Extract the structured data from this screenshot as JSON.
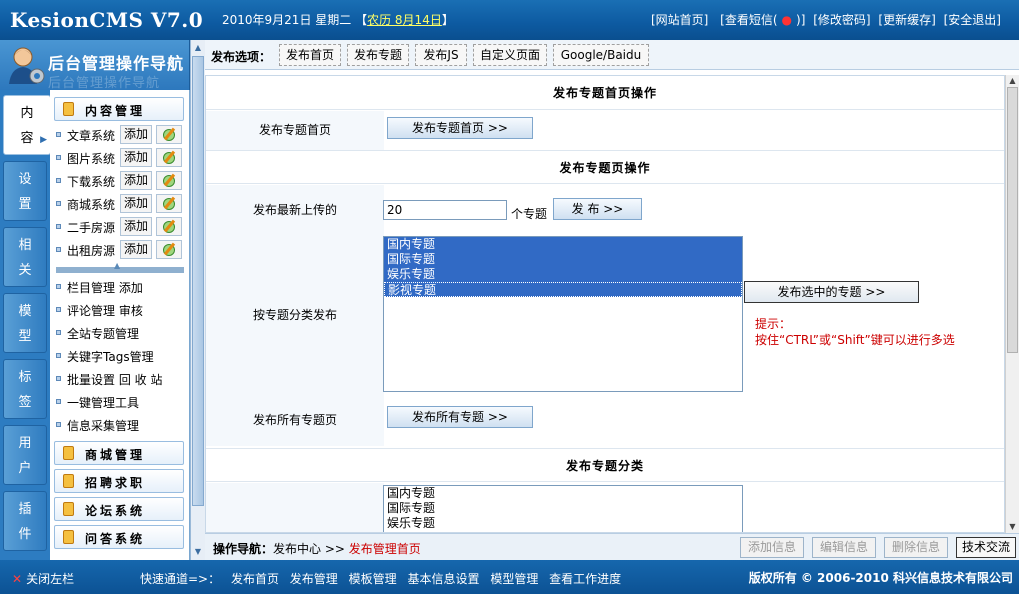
{
  "header": {
    "logo": "KesionCMS V7.0",
    "date": "2010年9月21日 星期二",
    "lunar_prefix": "【",
    "lunar": "农历 8月14日",
    "lunar_suffix": "】",
    "links": [
      "[网站首页]",
      "[查看短信(",
      ")]",
      "[修改密码]",
      "[更新缓存]",
      "[安全退出]"
    ]
  },
  "nav": {
    "title": "后台管理操作导航",
    "title_shadow": "后台管理操作导航",
    "vtabs": [
      {
        "label": "内容",
        "active": true
      },
      {
        "label": "设置"
      },
      {
        "label": "相关"
      },
      {
        "label": "模型"
      },
      {
        "label": "标签"
      },
      {
        "label": "用户"
      },
      {
        "label": "插件"
      }
    ],
    "group_content": "内容管理",
    "items_with_actions": [
      {
        "label": "文章系统",
        "add": "添加"
      },
      {
        "label": "图片系统",
        "add": "添加"
      },
      {
        "label": "下载系统",
        "add": "添加"
      },
      {
        "label": "商城系统",
        "add": "添加"
      },
      {
        "label": "二手房源",
        "add": "添加"
      },
      {
        "label": "出租房源",
        "add": "添加"
      }
    ],
    "items": [
      "栏目管理 添加",
      "评论管理 审核",
      "全站专题管理",
      "关键字Tags管理",
      "批量设置 回 收 站",
      "一键管理工具",
      "信息采集管理"
    ],
    "groups": [
      "商城管理",
      "招聘求职",
      "论坛系统",
      "问答系统"
    ]
  },
  "options": {
    "label": "发布选项：",
    "tabs": [
      "发布首页",
      "发布专题",
      "发布JS",
      "自定义页面",
      "Google/Baidu"
    ]
  },
  "main": {
    "sec1_title": "发布专题首页操作",
    "row1_label": "发布专题首页",
    "row1_button": "发布专题首页 >>",
    "sec2_title": "发布专题页操作",
    "row2_label": "发布最新上传的",
    "row2_input": "20",
    "row2_unit": "个专题",
    "row2_button": "发 布 >>",
    "row3_label": "按专题分类发布",
    "topics": [
      "国内专题",
      "国际专题",
      "娱乐专题",
      "影视专题"
    ],
    "row3_button": "发布选中的专题 >>",
    "hint_title": "提示：",
    "hint_text": "按住“CTRL”或“Shift”键可以进行多选",
    "row4_label": "发布所有专题页",
    "row4_button": "发布所有专题 >>",
    "sec3_title": "发布专题分类",
    "topics2": [
      "国内专题",
      "国际专题",
      "娱乐专题"
    ]
  },
  "opbar": {
    "label": "操作导航：",
    "path": "发布中心 >>",
    "current": "发布管理首页",
    "buttons": [
      "添加信息",
      "编辑信息",
      "删除信息",
      "技术交流"
    ]
  },
  "footer": {
    "close": "关闭左栏",
    "quick_label": "快速通道=>：",
    "quick": [
      "发布首页",
      "发布管理",
      "模板管理",
      "基本信息设置",
      "模型管理",
      "查看工作进度"
    ],
    "copyright": "版权所有 © 2006-2010 科兴信息技术有限公司"
  },
  "colors": {
    "header_blue": "#0d5aa1",
    "selected": "#316ac5",
    "hint_red": "#cc0000"
  }
}
